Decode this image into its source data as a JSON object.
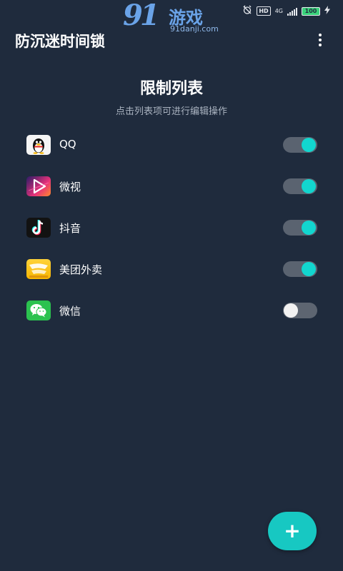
{
  "status_bar": {
    "hd": "HD",
    "network": "4G",
    "battery": "100",
    "icons": [
      "alarm-off-icon",
      "signal-icon",
      "battery-icon",
      "charging-icon"
    ]
  },
  "watermark": {
    "number": "91",
    "brand": "游戏",
    "url": "91danji.com"
  },
  "app_bar": {
    "title": "防沉迷时间锁",
    "menu_icon": "more-vert-icon"
  },
  "section": {
    "title": "限制列表",
    "subtitle": "点击列表项可进行编辑操作"
  },
  "apps": [
    {
      "name": "QQ",
      "icon": "qq-icon",
      "enabled": true
    },
    {
      "name": "微视",
      "icon": "weishi-icon",
      "enabled": true
    },
    {
      "name": "抖音",
      "icon": "douyin-icon",
      "enabled": true
    },
    {
      "name": "美团外卖",
      "icon": "meituan-icon",
      "enabled": true
    },
    {
      "name": "微信",
      "icon": "wechat-icon",
      "enabled": false
    }
  ],
  "fab": {
    "label": "+",
    "icon": "add-icon"
  },
  "colors": {
    "background": "#1f2b3d",
    "accent": "#12d6cf",
    "toggle_track": "#5a6370",
    "subtitle": "#aab3c0"
  }
}
